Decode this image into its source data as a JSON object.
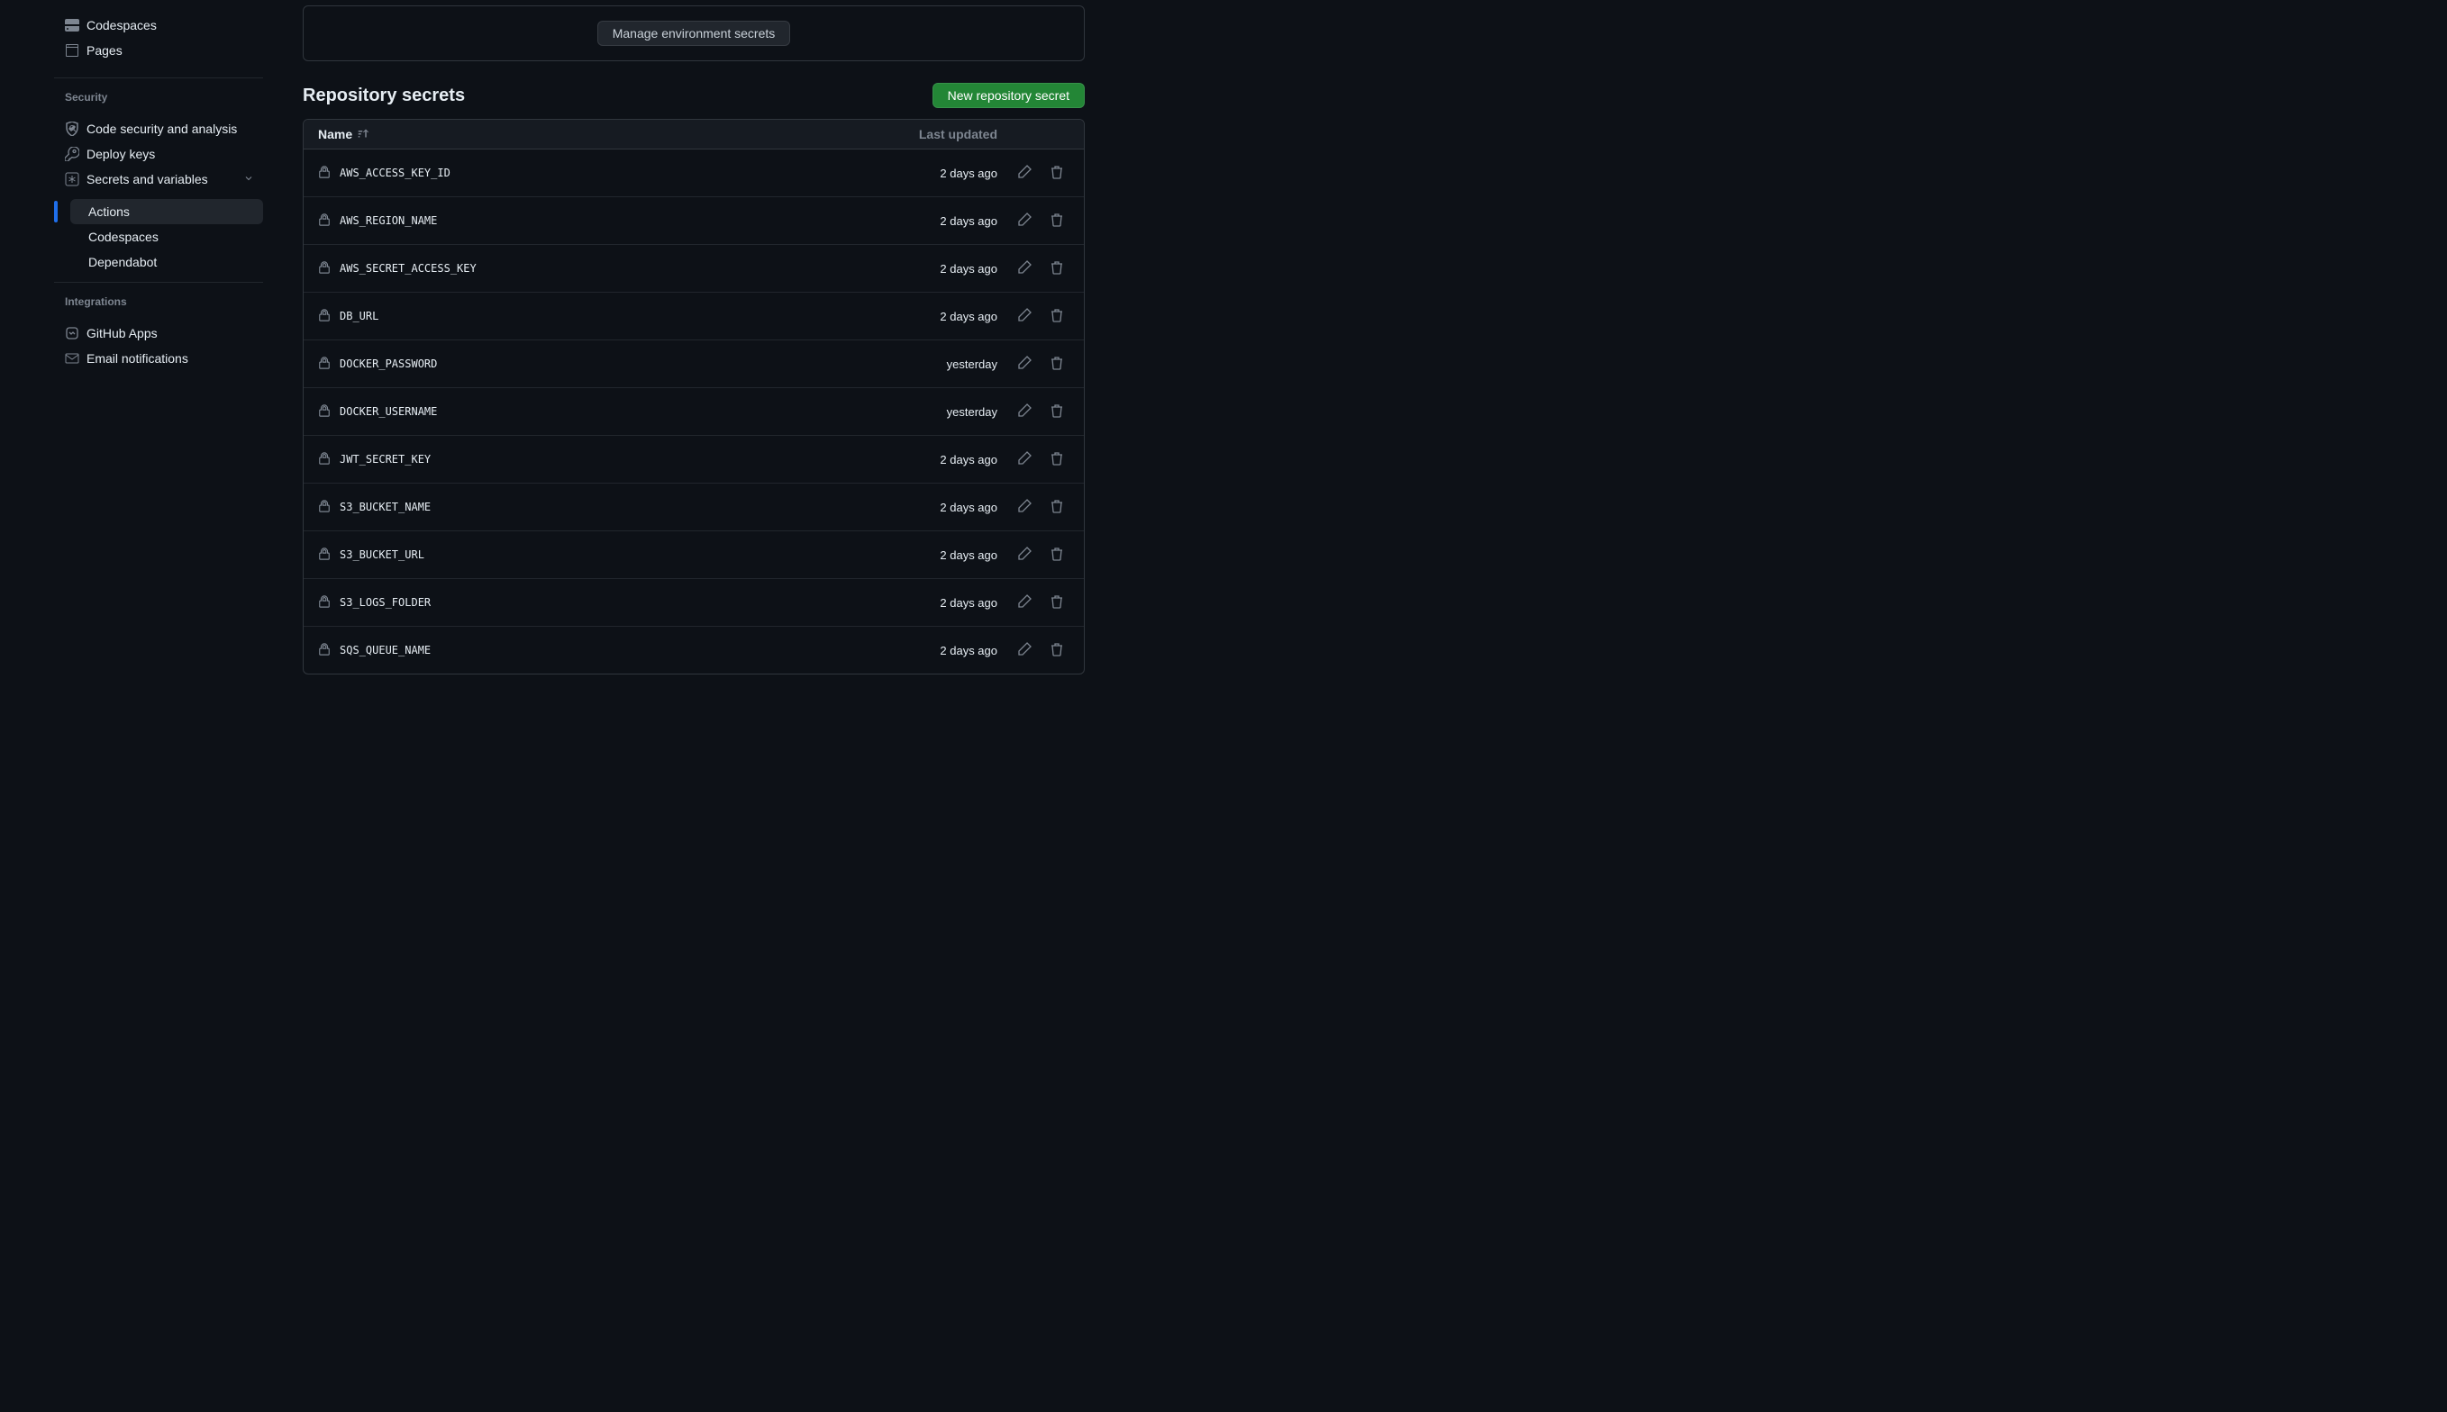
{
  "sidebar": {
    "top_items": [
      {
        "label": "Codespaces",
        "icon": "codespaces"
      },
      {
        "label": "Pages",
        "icon": "browser"
      }
    ],
    "security_heading": "Security",
    "security_items": [
      {
        "label": "Code security and analysis",
        "icon": "shield-scan"
      },
      {
        "label": "Deploy keys",
        "icon": "key"
      },
      {
        "label": "Secrets and variables",
        "icon": "asterisk",
        "expanded": true
      }
    ],
    "secrets_sub": [
      {
        "label": "Actions",
        "active": true
      },
      {
        "label": "Codespaces"
      },
      {
        "label": "Dependabot"
      }
    ],
    "integrations_heading": "Integrations",
    "integrations_items": [
      {
        "label": "GitHub Apps",
        "icon": "hubot"
      },
      {
        "label": "Email notifications",
        "icon": "mail"
      }
    ]
  },
  "env_panel": {
    "manage_button": "Manage environment secrets"
  },
  "repo_secrets": {
    "title": "Repository secrets",
    "new_button": "New repository secret",
    "col_name": "Name",
    "col_updated": "Last updated",
    "rows": [
      {
        "name": "AWS_ACCESS_KEY_ID",
        "updated": "2 days ago"
      },
      {
        "name": "AWS_REGION_NAME",
        "updated": "2 days ago"
      },
      {
        "name": "AWS_SECRET_ACCESS_KEY",
        "updated": "2 days ago"
      },
      {
        "name": "DB_URL",
        "updated": "2 days ago"
      },
      {
        "name": "DOCKER_PASSWORD",
        "updated": "yesterday"
      },
      {
        "name": "DOCKER_USERNAME",
        "updated": "yesterday"
      },
      {
        "name": "JWT_SECRET_KEY",
        "updated": "2 days ago"
      },
      {
        "name": "S3_BUCKET_NAME",
        "updated": "2 days ago"
      },
      {
        "name": "S3_BUCKET_URL",
        "updated": "2 days ago"
      },
      {
        "name": "S3_LOGS_FOLDER",
        "updated": "2 days ago"
      },
      {
        "name": "SQS_QUEUE_NAME",
        "updated": "2 days ago"
      }
    ]
  }
}
